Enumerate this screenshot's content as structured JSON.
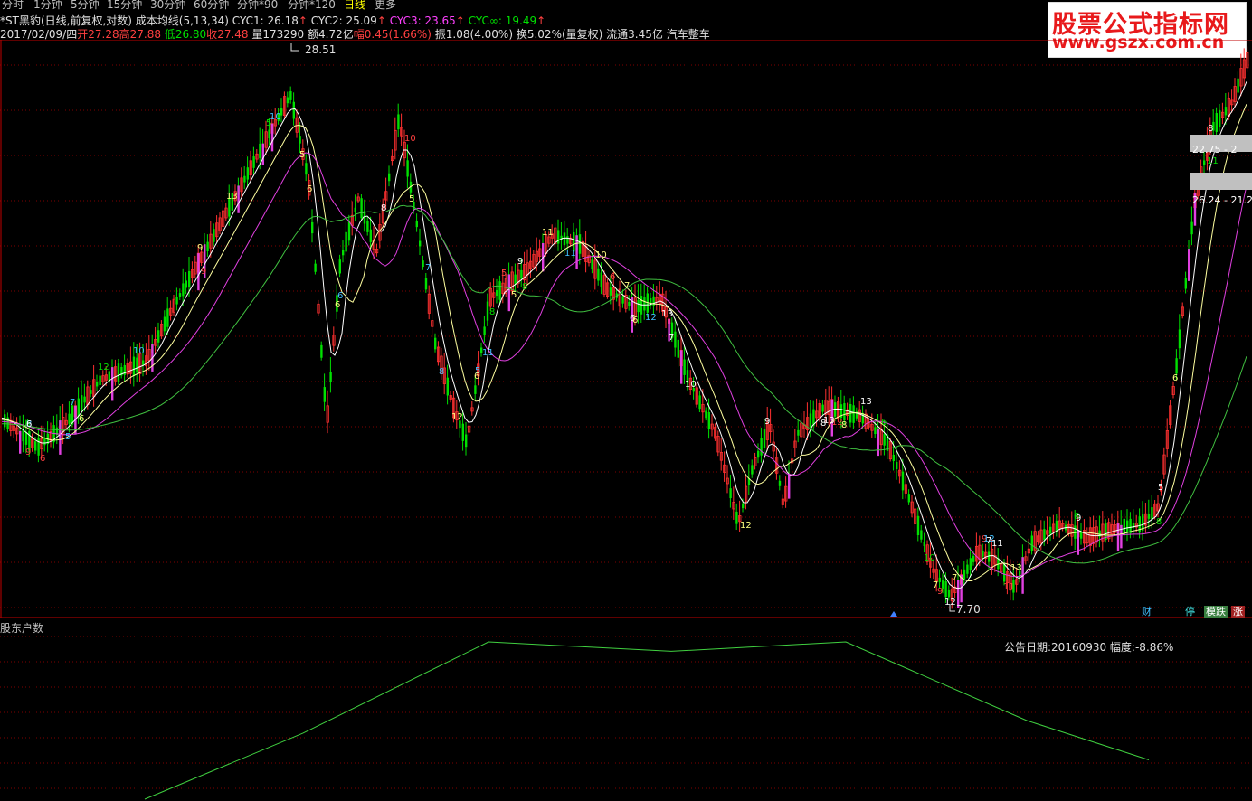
{
  "tabs": [
    {
      "label": "分时"
    },
    {
      "label": "1分钟"
    },
    {
      "label": "5分钟"
    },
    {
      "label": "15分钟"
    },
    {
      "label": "30分钟"
    },
    {
      "label": "60分钟"
    },
    {
      "label": "分钟*90"
    },
    {
      "label": "分钟*120"
    },
    {
      "label": "日线",
      "active": true
    },
    {
      "label": "更多"
    }
  ],
  "header": {
    "stock_name": "*ST黑豹(日线,前复权,对数)",
    "indicator": "成本均线(5,13,34)",
    "cyc1": "CYC1: 26.18",
    "cyc2": "CYC2: 25.09",
    "cyc3": "CYC3: 23.65",
    "cyc_inf": "CYC∞: 19.49",
    "arrow": "↑",
    "date": "2017/02/09/四",
    "open_label": "开",
    "open_value": "27.28",
    "high_label": "高",
    "high_value": "27.88",
    "low_label": "低",
    "low_value": "26.80",
    "close_label": "收",
    "close_value": "27.48",
    "volume": "量173290",
    "amount": "额4.72亿",
    "change_label": "幅",
    "change_value": "0.45(1.66%)",
    "amplitude": "振1.08(4.00%)",
    "turnover": "换5.02%(量复权)",
    "float": "流通3.45亿",
    "sector": "汽车整车"
  },
  "logo": {
    "line1": "股票公式指标网",
    "line2": "www.gszx.com.cn"
  },
  "chart_labels": {
    "high_mark": "28.51",
    "low_mark": "7.70",
    "right_box1": "22.75 - 2",
    "right_box2": "26.24 - 21.20"
  },
  "badges": [
    {
      "label": "财",
      "color": "#40c0ff"
    },
    {
      "label": "停",
      "color": "#40e0e0"
    },
    {
      "label": "模跌",
      "color": "#ffffff"
    },
    {
      "label": "涨",
      "color": "#ffffff"
    }
  ],
  "subpanel": {
    "title": "股东户数",
    "annotation": "公告日期:20160930 幅度:-8.86%"
  },
  "colors": {
    "up": "#ff3030",
    "down": "#00e000",
    "ma_white": "#ffffff",
    "ma_yellow": "#ffffa0",
    "ma_magenta": "#e040e0",
    "ma_green": "#40c040",
    "grid": "#800000"
  },
  "chart_data": {
    "type": "line",
    "title": "股东户数",
    "series": [
      {
        "name": "股东户数",
        "values": [
          0.0,
          0.42,
          1.0,
          0.94,
          1.0,
          0.5,
          0.25
        ]
      }
    ]
  }
}
